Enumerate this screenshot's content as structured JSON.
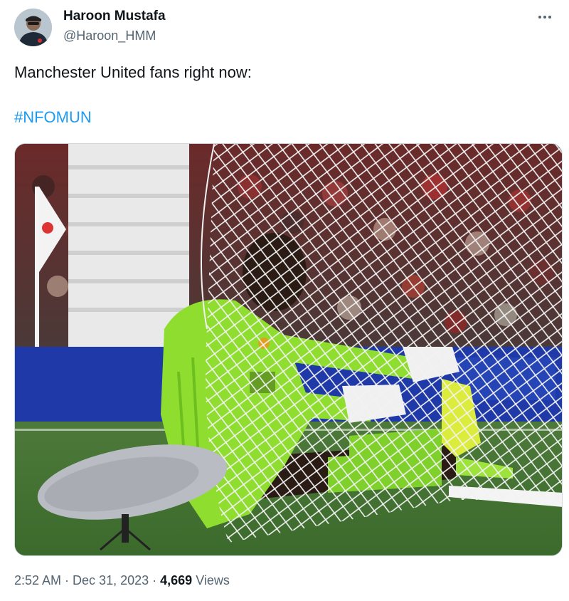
{
  "author": {
    "name": "Haroon Mustafa",
    "handle": "@Haroon_HMM",
    "avatar_icon": "user-avatar-icon"
  },
  "tweet": {
    "text": "Manchester United fans right now:",
    "hashtag": "#NFOMUN",
    "media_description_icon": "photo-goalkeeper-in-net-icon"
  },
  "meta": {
    "time": "2:52 AM",
    "date": "Dec 31, 2023",
    "views_count": "4,669",
    "views_label": "Views",
    "separator": "·"
  },
  "colors": {
    "text": "#0f1419",
    "secondary": "#536471",
    "link": "#1d9bf0",
    "border": "#cfd9de"
  }
}
